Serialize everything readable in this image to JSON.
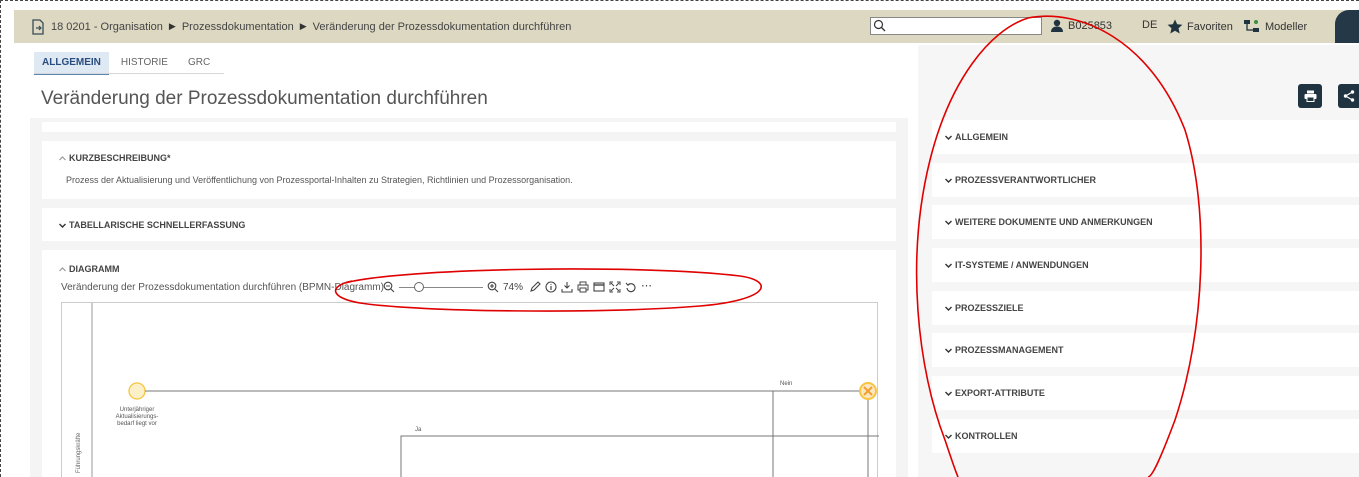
{
  "header": {
    "breadcrumb": [
      "18 0201 - Organisation",
      "Prozessdokumentation",
      "Veränderung der Prozessdokumentation durchführen"
    ],
    "search": {
      "value": "",
      "placeholder": ""
    },
    "user_id": "B025853",
    "language": "DE",
    "favorites_label": "Favoriten",
    "modeller_label": "Modeller"
  },
  "tabs": [
    {
      "label": "ALLGEMEIN",
      "active": true
    },
    {
      "label": "HISTORIE",
      "active": false
    },
    {
      "label": "GRC",
      "active": false
    }
  ],
  "page_title": "Veränderung der Prozessdokumentation durchführen",
  "sections": {
    "kurz": {
      "title": "KURZBESCHREIBUNG*",
      "text": "Prozess der Aktualisierung und Veröffentlichung von Prozessportal-Inhalten zu Strategien, Richtlinien und Prozessorganisation."
    },
    "tabellarisch": {
      "title": "TABELLARISCHE SCHNELLERFASSUNG"
    },
    "diagramm": {
      "title": "DIAGRAMM",
      "caption": "Veränderung der Prozessdokumentation durchführen (BPMN-Diagramm)",
      "zoom_fraction": 0.2,
      "zoom": "74%",
      "lane_label": "Führungskräfte",
      "start_event_label": [
        "Unterjähriger",
        "Aktualisierungs-",
        "bedarf liegt vor"
      ],
      "flow_label_no": "Nein",
      "flow_label_yes": "Ja"
    }
  },
  "accordion": [
    "ALLGEMEIN",
    "PROZESSVERANTWORTLICHER",
    "WEITERE DOKUMENTE UND ANMERKUNGEN",
    "IT-SYSTEME / ANWENDUNGEN",
    "PROZESSZIELE",
    "PROZESSMANAGEMENT",
    "EXPORT-ATTRIBUTE",
    "KONTROLLEN"
  ],
  "icons": {
    "document": "document-icon",
    "search": "search-icon",
    "user": "user-icon",
    "favorites": "star-icon",
    "modeller": "modeller-icon",
    "print": "print-icon",
    "share": "share-icon"
  },
  "colors": {
    "header_bg": "#ddd8c2",
    "accent_dark": "#1f3340",
    "annotation_red": "#e00000",
    "bpmn_event": "#f5c542"
  }
}
